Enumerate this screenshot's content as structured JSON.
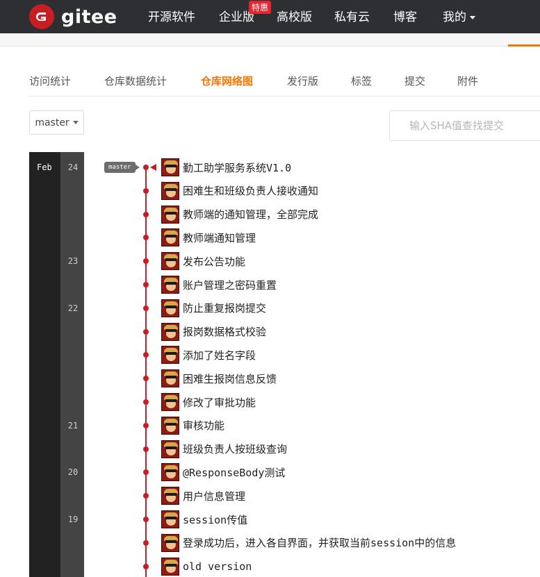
{
  "topnav": {
    "logo_text": "gitee",
    "items": [
      "开源软件",
      "企业版",
      "高校版",
      "私有云",
      "博客",
      "我的"
    ],
    "hot_badge": "特惠"
  },
  "tabs": [
    {
      "label": "访问统计",
      "active": false
    },
    {
      "label": "仓库数据统计",
      "active": false
    },
    {
      "label": "仓库网络图",
      "active": true
    },
    {
      "label": "发行版",
      "active": false
    },
    {
      "label": "标签",
      "active": false
    },
    {
      "label": "提交",
      "active": false
    },
    {
      "label": "附件",
      "active": false
    }
  ],
  "branch_select": {
    "value": "master"
  },
  "sha_search": {
    "placeholder": "输入SHA值查找提交"
  },
  "graph": {
    "month": "Feb",
    "branch_tag": "master",
    "days": [
      {
        "day": "24",
        "row": 0
      },
      {
        "day": "23",
        "row": 4
      },
      {
        "day": "22",
        "row": 6
      },
      {
        "day": "21",
        "row": 11
      },
      {
        "day": "20",
        "row": 13
      },
      {
        "day": "19",
        "row": 15
      }
    ],
    "commits": [
      "勤工助学服务系统V1.0",
      "困难生和班级负责人接收通知",
      "教师端的通知管理，全部完成",
      "教师端通知管理",
      "发布公告功能",
      "账户管理之密码重置",
      "防止重复报岗提交",
      "报岗数据格式校验",
      "添加了姓名字段",
      "困难生报岗信息反馈",
      "修改了审批功能",
      "审核功能",
      "班级负责人按班级查询",
      "@ResponseBody测试",
      "用户信息管理",
      "session传值",
      "登录成功后，进入各自界面，并获取当前session中的信息",
      "old version"
    ]
  },
  "colors": {
    "nav_bg": "#2d2f33",
    "brand_red": "#c71d23",
    "accent_orange": "#fe7300"
  }
}
